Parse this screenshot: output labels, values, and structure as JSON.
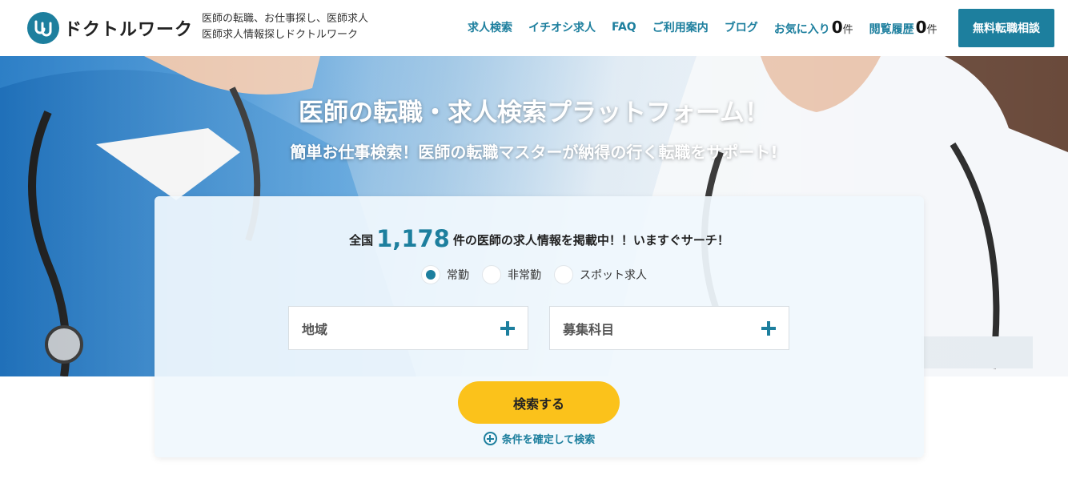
{
  "header": {
    "logo_text": "ドクトルワーク",
    "tagline_line1": "医師の転職、お仕事探し、医師求人",
    "tagline_line2": "医師求人情報探しドクトルワーク",
    "nav": [
      {
        "label": "求人検索"
      },
      {
        "label": "イチオシ求人"
      },
      {
        "label": "FAQ"
      },
      {
        "label": "ご利用案内"
      },
      {
        "label": "ブログ"
      }
    ],
    "favorites": {
      "label": "お気に入り",
      "count": "0",
      "unit": "件"
    },
    "history": {
      "label": "閲覧履歴",
      "count": "0",
      "unit": "件"
    },
    "cta_label": "無料転職相談"
  },
  "hero": {
    "title": "医師の転職・求人検索プラットフォーム！",
    "subtitle": "簡単お仕事検索！医師の転職マスターが納得の行く転職をサポート!"
  },
  "search": {
    "count_prefix": "全国",
    "count_value": "1,178",
    "count_suffix": "件の医師の求人情報を掲載中！！いますぐサーチ！",
    "radios": [
      {
        "label": "常勤",
        "selected": true
      },
      {
        "label": "非常勤",
        "selected": false
      },
      {
        "label": "スポット求人",
        "selected": false
      }
    ],
    "region_label": "地域",
    "specialty_label": "募集科目",
    "submit_label": "検索する",
    "confirm_label": "条件を確定して検索"
  },
  "colors": {
    "accent": "#1d7f9e",
    "button": "#fbc21b"
  }
}
